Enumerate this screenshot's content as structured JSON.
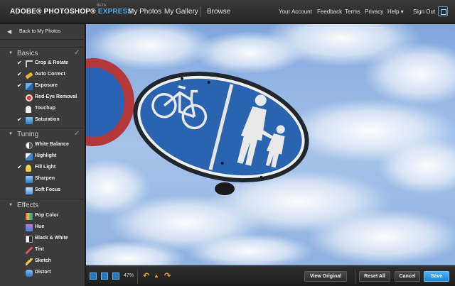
{
  "header": {
    "logo_main": "ADOBE® PHOTOSHOP®",
    "logo_express": "EXPRESS",
    "logo_beta": "BETA",
    "nav": [
      "My Photos",
      "My Gallery",
      "Browse"
    ],
    "links": [
      "Your Account",
      "Feedback",
      "Terms",
      "Privacy",
      "Help ▾",
      "Sign Out"
    ]
  },
  "sidebar": {
    "back_label": "Back to My Photos",
    "sections": [
      {
        "title": "Basics",
        "completed": true,
        "tools": [
          {
            "label": "Crop & Rotate",
            "checked": true,
            "icon": "crop-icon"
          },
          {
            "label": "Auto Correct",
            "checked": true,
            "icon": "auto-correct-icon"
          },
          {
            "label": "Exposure",
            "checked": true,
            "icon": "exposure-icon"
          },
          {
            "label": "Red-Eye Removal",
            "checked": false,
            "icon": "red-eye-icon"
          },
          {
            "label": "Touchup",
            "checked": false,
            "icon": "touchup-icon"
          },
          {
            "label": "Saturation",
            "checked": true,
            "icon": "saturation-icon"
          }
        ]
      },
      {
        "title": "Tuning",
        "completed": true,
        "tools": [
          {
            "label": "White Balance",
            "checked": false,
            "icon": "white-balance-icon"
          },
          {
            "label": "Highlight",
            "checked": false,
            "icon": "highlight-icon"
          },
          {
            "label": "Fill Light",
            "checked": true,
            "icon": "fill-light-icon"
          },
          {
            "label": "Sharpen",
            "checked": false,
            "icon": "sharpen-icon"
          },
          {
            "label": "Soft Focus",
            "checked": false,
            "icon": "soft-focus-icon"
          }
        ]
      },
      {
        "title": "Effects",
        "completed": false,
        "tools": [
          {
            "label": "Pop Color",
            "checked": false,
            "icon": "pop-color-icon"
          },
          {
            "label": "Hue",
            "checked": false,
            "icon": "hue-icon"
          },
          {
            "label": "Black & White",
            "checked": false,
            "icon": "black-white-icon"
          },
          {
            "label": "Tint",
            "checked": false,
            "icon": "tint-icon"
          },
          {
            "label": "Sketch",
            "checked": false,
            "icon": "sketch-icon"
          },
          {
            "label": "Distort",
            "checked": false,
            "icon": "distort-icon"
          }
        ]
      }
    ]
  },
  "bottom": {
    "zoom": "47%",
    "view_original": "View Original",
    "reset_all": "Reset All",
    "cancel": "Cancel",
    "save": "Save"
  },
  "colors": {
    "accent": "#2a8be0",
    "sign_blue": "#2860b0",
    "sky": "#8fb4e2",
    "history_arrow": "#e9a21c"
  }
}
